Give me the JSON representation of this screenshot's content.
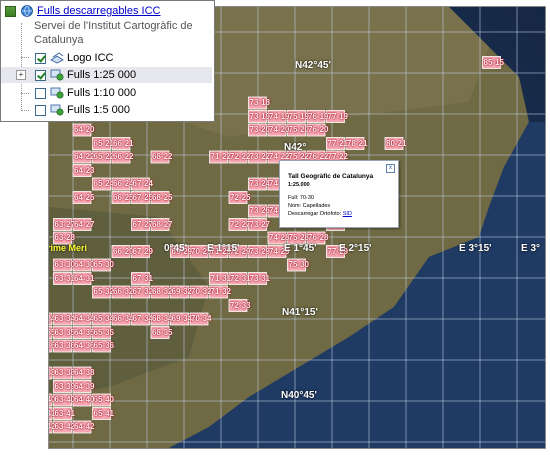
{
  "layer_panel": {
    "title": "Fulls descarregables ICC",
    "subtitle_line1": "Servei de l'Institut Cartogràfic de",
    "subtitle_line2": "Catalunya",
    "items": [
      {
        "label": "Logo ICC",
        "checked": true,
        "icon": "logo-layer-icon"
      },
      {
        "label": "Fulls 1:25 000",
        "checked": true,
        "icon": "tile-layer-icon",
        "expander": "+"
      },
      {
        "label": "Fulls 1:10 000",
        "checked": false,
        "icon": "tile-layer-icon"
      },
      {
        "label": "Fulls 1:5 000",
        "checked": false,
        "icon": "tile-layer-icon"
      }
    ]
  },
  "popup": {
    "title": "Tall Geogràfic de Catalunya",
    "scale": "1:25.000",
    "full_label": "Full: 70-30",
    "nom_label": "Nom: Capellades",
    "download_label": "Descarregar Ortofoto:",
    "download_link": "SID",
    "close": "x"
  },
  "coordinates": {
    "lat_42_45": "N42°45'",
    "lat_42": "N42°",
    "lat_41_15": "N41°15'",
    "lat_40_45": "N40°45'",
    "lon_45_a": "0°45'",
    "lon_1_15": "E 1°15'",
    "lon_45_b": "E 1°45'",
    "lon_2_15": "E 2°15'",
    "lon_3_15": "E 3°15'",
    "lon_3_edge": "E 3°",
    "meridian": "rime Meri"
  },
  "tile_labels": [
    "85-15",
    "68-17",
    "73-18",
    "73-19",
    "74-19",
    "75-19",
    "76-19",
    "77-19",
    "64-20",
    "65-21",
    "66-21",
    "73-20",
    "74-20",
    "75-20",
    "76-20",
    "77-21",
    "78-21",
    "80-21",
    "64-22",
    "65-22",
    "66-22",
    "68-22",
    "71-22",
    "72-22",
    "73-22",
    "74-22",
    "75-22",
    "76-22",
    "77-22",
    "64-23",
    "65-24",
    "66-24",
    "67-24",
    "73-24",
    "74-24",
    "75-24",
    "76-24",
    "77-24",
    "64-25",
    "66-25",
    "67-25",
    "68-25",
    "72-25",
    "73-26",
    "74-26",
    "75-26",
    "76-26",
    "77-27",
    "63-27",
    "64-27",
    "67-27",
    "68-27",
    "72-27",
    "73-27",
    "74-28",
    "75-28",
    "76-28",
    "63-28",
    "66-29",
    "67-29",
    "69-29",
    "70-29",
    "71-29",
    "72-29",
    "73-29",
    "74-29",
    "77-29",
    "63-30",
    "64-30",
    "65-30",
    "67-31",
    "71-31",
    "72-31",
    "73-31",
    "75-30",
    "63-31",
    "64-31",
    "65-32",
    "66-32",
    "67-32",
    "68-32",
    "69-32",
    "70-32",
    "71-32",
    "72-33",
    "61-34",
    "62-34",
    "63-34",
    "64-34",
    "65-34",
    "66-34",
    "67-34",
    "68-34",
    "69-34",
    "70-34",
    "61-35",
    "62-35",
    "63-35",
    "64-35",
    "65-35",
    "68-35",
    "60-36",
    "62-36",
    "63-36",
    "64-36",
    "65-36",
    "61-38",
    "62-38",
    "63-38",
    "64-38",
    "60-39",
    "63-39",
    "64-39",
    "65-40",
    "62-40",
    "63-40",
    "64-40",
    "62-41",
    "63-41",
    "65-41",
    "62-42",
    "63-42",
    "64-42"
  ]
}
